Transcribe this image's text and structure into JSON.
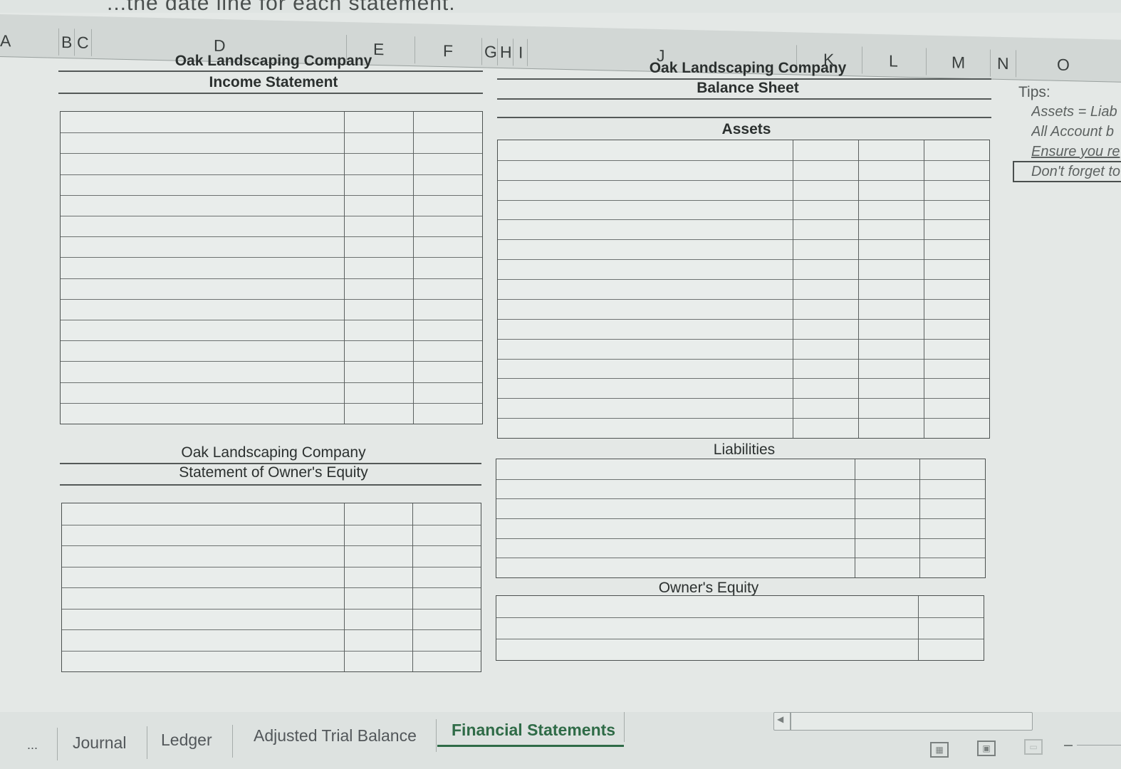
{
  "instruction_fragment": "...the date line for each statement.",
  "columns": [
    "A",
    "B",
    "C",
    "D",
    "E",
    "F",
    "G",
    "H",
    "I",
    "J",
    "K",
    "L",
    "M",
    "N",
    "O"
  ],
  "income_statement": {
    "company": "Oak Landscaping Company",
    "title": "Income Statement"
  },
  "owners_equity_statement": {
    "company": "Oak Landscaping Company",
    "title": "Statement of  Owner's Equity"
  },
  "balance_sheet": {
    "company": "Oak Landscaping Company",
    "title": "Balance Sheet",
    "assets_label": "Assets",
    "liabilities_label": "Liabilities",
    "owners_equity_label": "Owner's Equity"
  },
  "tips": {
    "label": "Tips:",
    "items": [
      "Assets = Liab",
      "All Account b",
      "Ensure you re",
      "Don't forget to"
    ]
  },
  "sheet_tabs": {
    "overflow": "...",
    "tabs": [
      "Journal",
      "Ledger",
      "Adjusted Trial Balance",
      "Financial Statements"
    ],
    "active": "Financial Statements"
  }
}
